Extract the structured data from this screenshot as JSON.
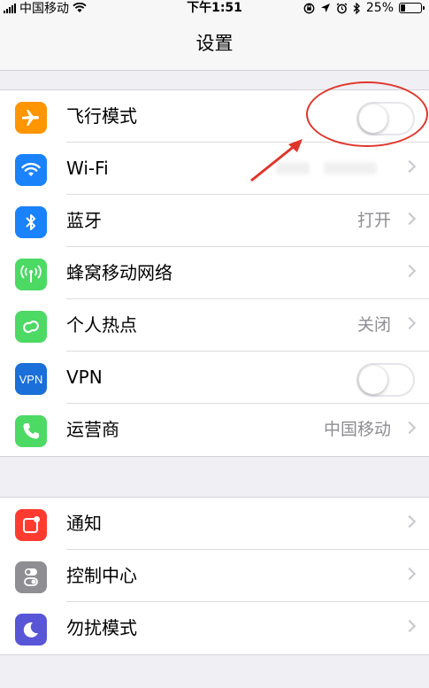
{
  "status_bar": {
    "carrier": "中国移动",
    "time": "下午1:51",
    "battery": "25%",
    "battery_level": 0.25
  },
  "nav": {
    "title": "设置"
  },
  "group1": [
    {
      "label": "飞行模式",
      "icon": "airplane-icon",
      "color": "#ff9500",
      "type": "toggle",
      "on": false
    },
    {
      "label": "Wi-Fi",
      "icon": "wifi-icon",
      "color": "#1a82fb",
      "type": "blurred"
    },
    {
      "label": "蓝牙",
      "icon": "bluetooth-icon",
      "color": "#1a82fb",
      "value": "打开",
      "type": "value"
    },
    {
      "label": "蜂窝移动网络",
      "icon": "cellular-icon",
      "color": "#4cd964",
      "type": "chevron"
    },
    {
      "label": "个人热点",
      "icon": "hotspot-icon",
      "color": "#4cd964",
      "value": "关闭",
      "type": "value"
    },
    {
      "label": "VPN",
      "icon": "vpn-icon",
      "icon_text": "VPN",
      "color": "#1a6fd8",
      "type": "toggle",
      "on": false
    },
    {
      "label": "运营商",
      "icon": "phone-icon",
      "color": "#4cd964",
      "value": "中国移动",
      "type": "value"
    }
  ],
  "group2": [
    {
      "label": "通知",
      "icon": "notifications-icon",
      "color": "#ff3b30",
      "type": "chevron"
    },
    {
      "label": "控制中心",
      "icon": "control-center-icon",
      "color": "#8e8e93",
      "type": "chevron"
    },
    {
      "label": "勿扰模式",
      "icon": "moon-icon",
      "color": "#5856d6",
      "type": "chevron"
    }
  ]
}
